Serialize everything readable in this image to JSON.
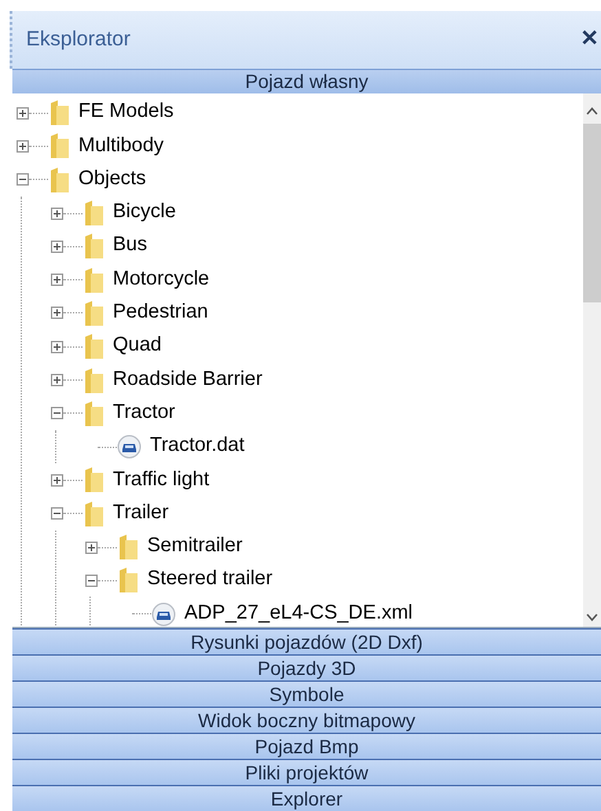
{
  "panel": {
    "title": "Eksplorator",
    "close": "✕"
  },
  "active_section": "Pojazd własny",
  "tree": [
    {
      "kind": "folder",
      "label": "FE Models",
      "expanded": false
    },
    {
      "kind": "folder",
      "label": "Multibody",
      "expanded": false
    },
    {
      "kind": "folder",
      "label": "Objects",
      "expanded": true,
      "children": [
        {
          "kind": "folder",
          "label": "Bicycle",
          "expanded": false
        },
        {
          "kind": "folder",
          "label": "Bus",
          "expanded": false
        },
        {
          "kind": "folder",
          "label": "Motorcycle",
          "expanded": false
        },
        {
          "kind": "folder",
          "label": "Pedestrian",
          "expanded": false
        },
        {
          "kind": "folder",
          "label": "Quad",
          "expanded": false
        },
        {
          "kind": "folder",
          "label": "Roadside Barrier",
          "expanded": false
        },
        {
          "kind": "folder",
          "label": "Tractor",
          "expanded": true,
          "children": [
            {
              "kind": "file",
              "label": "Tractor.dat"
            }
          ]
        },
        {
          "kind": "folder",
          "label": "Traffic light",
          "expanded": false
        },
        {
          "kind": "folder",
          "label": "Trailer",
          "expanded": true,
          "children": [
            {
              "kind": "folder",
              "label": "Semitrailer",
              "expanded": false
            },
            {
              "kind": "folder",
              "label": "Steered trailer",
              "expanded": true,
              "children": [
                {
                  "kind": "file",
                  "label": "ADP_27_eL4-CS_DE.xml"
                }
              ]
            }
          ]
        }
      ]
    }
  ],
  "sections": [
    "Rysunki pojazdów (2D Dxf)",
    "Pojazdy 3D",
    "Symbole",
    "Widok boczny bitmapowy",
    "Pojazd Bmp",
    "Pliki projektów",
    "Explorer"
  ]
}
